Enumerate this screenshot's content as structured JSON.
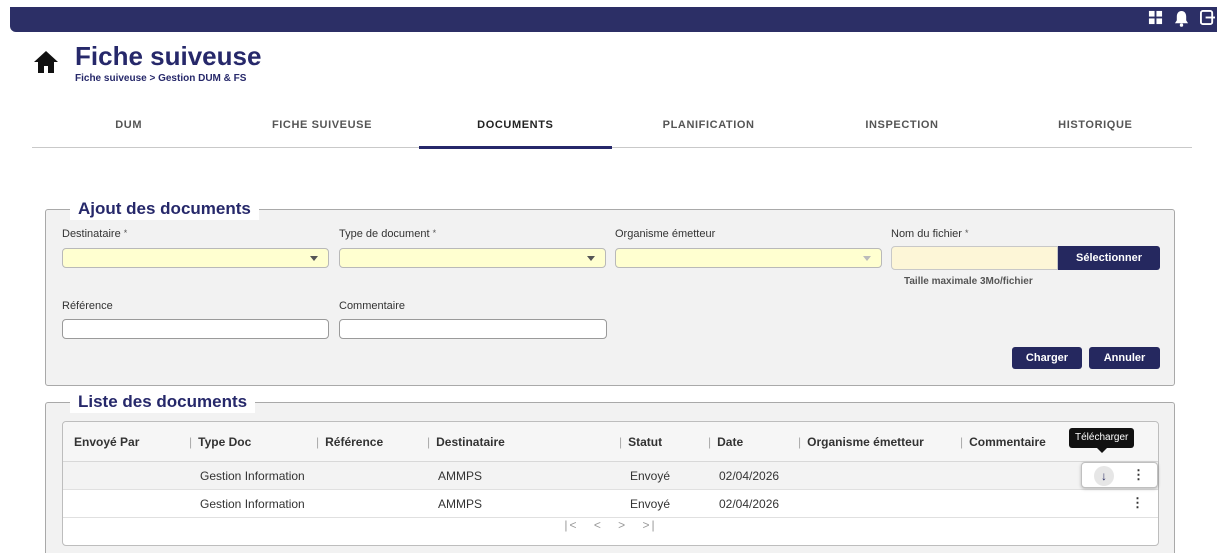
{
  "topbar": {
    "icons": [
      "grid-icon",
      "bell-icon",
      "exit-icon"
    ]
  },
  "header": {
    "title": "Fiche suiveuse",
    "breadcrumb": "Fiche suiveuse > Gestion DUM & FS"
  },
  "tabs": [
    {
      "label": "DUM",
      "active": false
    },
    {
      "label": "FICHE SUIVEUSE",
      "active": false
    },
    {
      "label": "DOCUMENTS",
      "active": true
    },
    {
      "label": "PLANIFICATION",
      "active": false
    },
    {
      "label": "INSPECTION",
      "active": false
    },
    {
      "label": "HISTORIQUE",
      "active": false
    }
  ],
  "ajout": {
    "legend": "Ajout des documents",
    "destinataire_label": "Destinataire",
    "type_doc_label": "Type de document",
    "organisme_label": "Organisme émetteur",
    "nom_fichier_label": "Nom du fichier",
    "required_mark": "*",
    "select_file_button": "Sélectionner",
    "max_size_hint": "Taille maximale 3Mo/fichier",
    "reference_label": "Référence",
    "commentaire_label": "Commentaire",
    "charger_button": "Charger",
    "annuler_button": "Annuler"
  },
  "liste": {
    "legend": "Liste des documents",
    "columns": [
      "Envoyé Par",
      "Type Doc",
      "Référence",
      "Destinataire",
      "Statut",
      "Date",
      "Organisme émetteur",
      "Commentaire"
    ],
    "rows": [
      {
        "envoye_par": "",
        "type_doc": "Gestion Information",
        "reference": "",
        "destinataire": "AMMPS",
        "statut": "Envoyé",
        "date": "02/04/2026",
        "organisme": "",
        "commentaire": ""
      },
      {
        "envoye_par": "",
        "type_doc": "Gestion Information",
        "reference": "",
        "destinataire": "AMMPS",
        "statut": "Envoyé",
        "date": "02/04/2026",
        "organisme": "",
        "commentaire": ""
      }
    ],
    "tooltip": "Télécharger",
    "pager": {
      "first": "|<",
      "prev": "<",
      "next": ">",
      "last": ">|"
    }
  },
  "colors": {
    "brand": "#26286a",
    "button": "#25285f",
    "field_highlight": "#ffffd0"
  }
}
